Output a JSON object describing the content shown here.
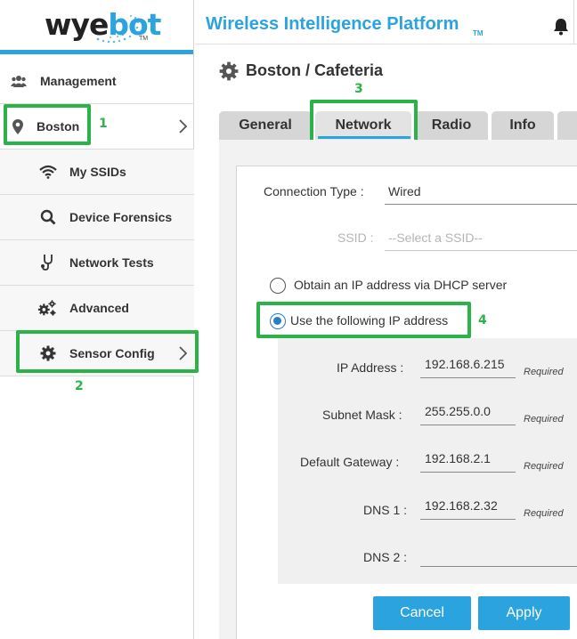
{
  "sidebar": {
    "logo_text_1": "wye",
    "logo_text_2": "bot",
    "logo_tm": "TM",
    "items": [
      {
        "label": "Management"
      },
      {
        "label": "Boston"
      },
      {
        "label": "My SSIDs"
      },
      {
        "label": "Device Forensics"
      },
      {
        "label": "Network Tests"
      },
      {
        "label": "Advanced"
      },
      {
        "label": "Sensor Config"
      }
    ]
  },
  "header": {
    "title": "Wireless Intelligence Platform",
    "tm": "TM"
  },
  "main": {
    "breadcrumb": "Boston / Cafeteria",
    "tabs": [
      {
        "label": "General"
      },
      {
        "label": "Network"
      },
      {
        "label": "Radio"
      },
      {
        "label": "Info"
      }
    ],
    "active_tab": "Network",
    "connection_type_label": "Connection Type :",
    "connection_type_value": "Wired",
    "ssid_label": "SSID :",
    "ssid_placeholder": "--Select a SSID--",
    "dhcp_option": "Obtain an IP address via DHCP server",
    "static_option": "Use the following IP address",
    "selected_option": "static",
    "ip_address_label": "IP Address :",
    "ip_address_value": "192.168.6.215",
    "subnet_mask_label": "Subnet Mask :",
    "subnet_mask_value": "255.255.0.0",
    "gateway_label": "Default Gateway :",
    "gateway_value": "192.168.2.1",
    "dns1_label": "DNS 1 :",
    "dns1_value": "192.168.2.32",
    "dns2_label": "DNS 2 :",
    "dns2_value": "",
    "required_text": "Required",
    "cancel_label": "Cancel",
    "apply_label": "Apply"
  },
  "annotations": {
    "a1": "1",
    "a2": "2",
    "a3": "3",
    "a4": "4"
  },
  "colors": {
    "accent": "#2aa3de",
    "annotation": "#2bb34a",
    "radio": "#2a7fc0"
  }
}
